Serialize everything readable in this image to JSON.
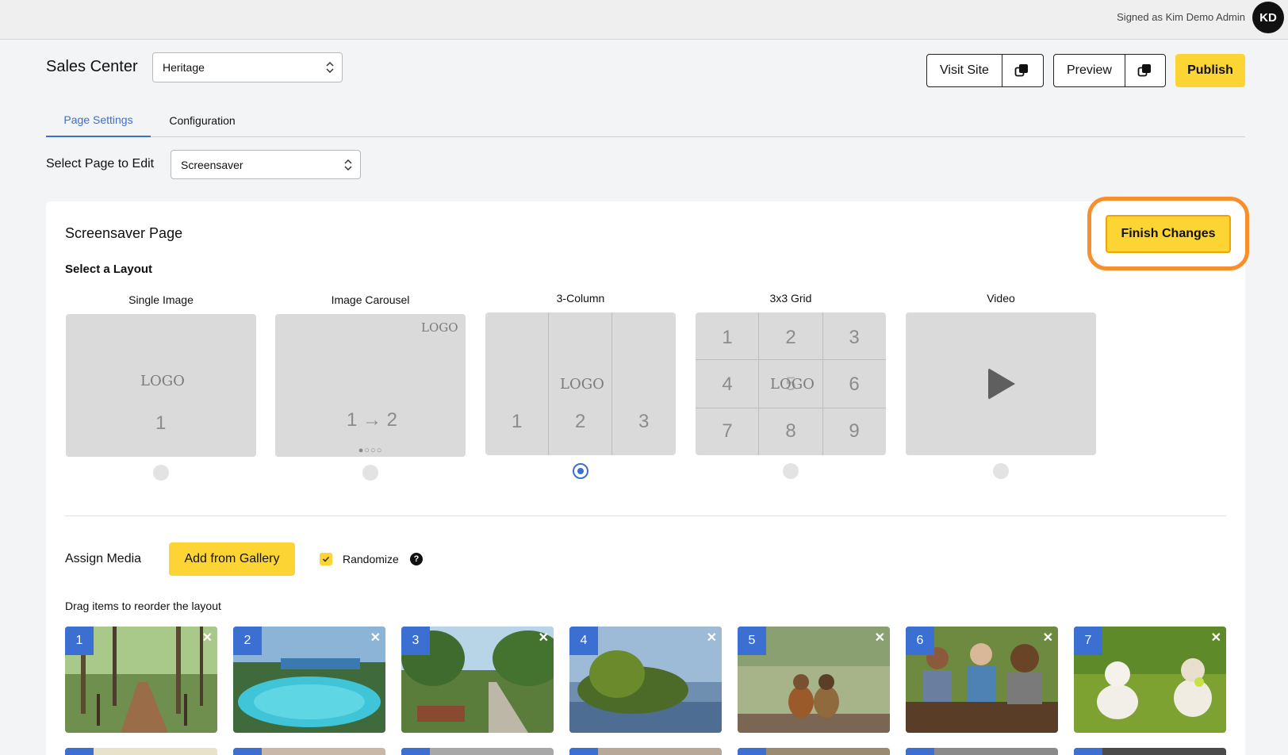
{
  "header": {
    "signed_in_text": "Signed as Kim Demo Admin",
    "avatar_initials": "KD"
  },
  "toolbar": {
    "app_title": "Sales Center",
    "site_select_value": "Heritage",
    "visit_site_label": "Visit Site",
    "preview_label": "Preview",
    "publish_label": "Publish"
  },
  "tabs": [
    {
      "label": "Page Settings",
      "active": true
    },
    {
      "label": "Configuration",
      "active": false
    }
  ],
  "page_select": {
    "label": "Select Page to Edit",
    "value": "Screensaver"
  },
  "card": {
    "title": "Screensaver Page",
    "finish_label": "Finish Changes",
    "layout_title": "Select a Layout"
  },
  "layouts": {
    "single": {
      "name": "Single Image",
      "logo": "LOGO",
      "nums": [
        "1"
      ],
      "selected": false
    },
    "carousel": {
      "name": "Image Carousel",
      "logo": "LOGO",
      "sequence": "1 → 2",
      "dots": "●○○○",
      "selected": false
    },
    "three_col": {
      "name": "3-Column",
      "logo": "LOGO",
      "nums": [
        "1",
        "2",
        "3"
      ],
      "selected": true
    },
    "grid": {
      "name": "3x3 Grid",
      "logo": "LOGO",
      "nums": [
        "1",
        "2",
        "3",
        "4",
        "5",
        "6",
        "7",
        "8",
        "9"
      ],
      "selected": false
    },
    "video": {
      "name": "Video",
      "selected": false
    }
  },
  "media": {
    "assign_label": "Assign Media",
    "add_label": "Add from Gallery",
    "randomize_label": "Randomize",
    "randomize_checked": true,
    "help_glyph": "?",
    "drag_hint": "Drag items to reorder the layout",
    "close_glyph": "✕",
    "items": [
      {
        "index": "1",
        "scene": "wooden-boardwalk-forest"
      },
      {
        "index": "2",
        "scene": "resort-pool"
      },
      {
        "index": "3",
        "scene": "park-path-trees"
      },
      {
        "index": "4",
        "scene": "lake-island-sunset"
      },
      {
        "index": "5",
        "scene": "kids-fishing-dock"
      },
      {
        "index": "6",
        "scene": "kids-gardening"
      },
      {
        "index": "7",
        "scene": "dogs-on-grass"
      }
    ]
  },
  "colors": {
    "accent_blue": "#3b6fd1",
    "brand_yellow": "#fcd535",
    "highlight_orange": "#f7902c"
  }
}
